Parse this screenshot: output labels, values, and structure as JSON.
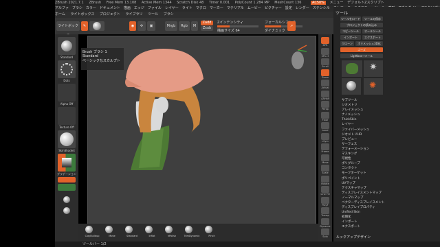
{
  "titlebar": {
    "items": [
      "ZBrush 2021.7.1",
      "ZBrush",
      "Free Mem 13.108",
      "Active Mem 1344",
      "Scratch Disk 48",
      "Timer 0.001",
      "PolyCount 1.284 MP",
      "MeshCount 136"
    ],
    "right_items": [
      "AC50%",
      "メニュー",
      "デフォルトZスクリプト"
    ]
  },
  "menubar": {
    "items": [
      "アルファ",
      "ブラシ",
      "カラー",
      "ドキュメント",
      "描画",
      "エッジ",
      "ファイル",
      "レイヤー",
      "ライト",
      "マクロ",
      "マーカー",
      "マテリアル",
      "ムービー",
      "ピクチャー",
      "設定",
      "レンダー",
      "ステンシル",
      "ストローク",
      "テクスチャ",
      "ツール",
      "変形",
      "Zプラグイン",
      "Zスクリプト",
      "ヘルプ"
    ]
  },
  "subbar": {
    "items": [
      "ホーム",
      "ライトボックス",
      "プロジェクト",
      "ライブラリ",
      "ツール",
      "ブラシ"
    ]
  },
  "toolbar": {
    "lightbox": "ライトボックス",
    "sliders": [
      {
        "label": "Zインテンシティ",
        "value": 0.3
      },
      {
        "label": "描画サイズ 64",
        "value": 0.45
      }
    ],
    "mode_buttons": [
      "Mrgb",
      "Rgb",
      "M"
    ],
    "zadd": "Zadd",
    "zsub": "Zsub",
    "focal": "フォーカルシフト 0",
    "dynamic": "ダイナミック"
  },
  "popup": {
    "title": "Brush  ブラシ 1",
    "line2": "Standard",
    "line3": "ベーシックなスカルプト"
  },
  "leftshelf": {
    "labels": [
      "Standard",
      "Dots",
      "Alpha Off",
      "Texture Off",
      "SkinShade4",
      "グラデーション"
    ]
  },
  "bottomshelf": {
    "brushes": [
      "ClayBuildup",
      "Move",
      "Standard",
      "Inflat",
      "hPolish",
      "TrimDynamic",
      "Pinch"
    ]
  },
  "statusbar": {
    "text": "ツールバー 1/2"
  },
  "rightshelf": {
    "labels": [
      "BPR",
      "SPix 3",
      "Scroll",
      "Zoom",
      "Actual",
      "AAHalf",
      "Persp",
      "Floor",
      "Local",
      "LSym",
      "Frame",
      "Move",
      "Scale",
      "Rotate",
      "Line Fill",
      "PolyF",
      "Transp",
      "Dynamic",
      "Solo"
    ]
  },
  "toolpanel": {
    "title": "ツール",
    "buttons": [
      "ツールをロード",
      "ツールの保存",
      "プロジェクトの読み込み",
      "コピーツール",
      "インポート",
      "エクスポート",
      "クローン",
      "ポリメッシュ3D化",
      "ゴーズ",
      "オールツール",
      "Lightbox→ツール"
    ],
    "list": [
      "サブツール",
      "ジオメトリ",
      "アレイメッシュ",
      "ナノメッシュ",
      "ThickSkin",
      "レイヤー",
      "ファイバーメッシュ",
      "ジオメトリHD",
      "プレビュー",
      "サーフェス",
      "デフォーメーション",
      "マスキング",
      "可視性",
      "ポリグループ",
      "コンタクト",
      "モーフターゲット",
      "ポリペイント",
      "UVマップ",
      "テクスチャマップ",
      "ディスプレイスメントマップ",
      "ノーマルマップ",
      "ベクターディスプレイスメント",
      "ディスプレイプロパティ",
      "Unified Skin",
      "初期化",
      "インポート",
      "エクスポート"
    ],
    "footer": "ルックアップデザイン"
  },
  "colors": {
    "accent": "#e2622a",
    "hat": "#e59b86",
    "hair": "#c9853e",
    "jacket": "#4d7a34"
  }
}
